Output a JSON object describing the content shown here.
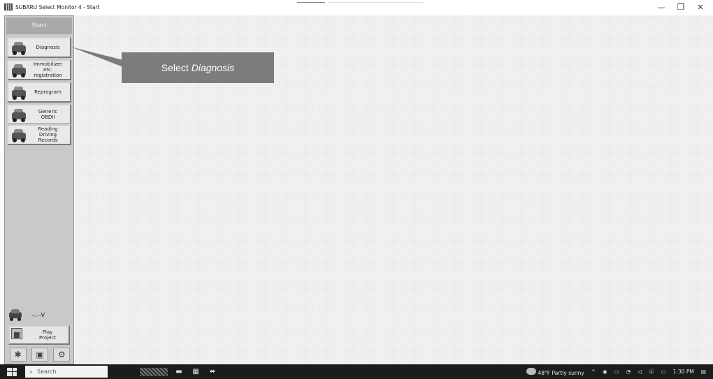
{
  "window": {
    "title": "SUBARU Select Monitor 4 - Start",
    "controls": {
      "minimize": "—",
      "maximize": "❐",
      "close": "✕"
    }
  },
  "sidebar": {
    "header": "Start",
    "buttons": [
      {
        "label": "Diagnosis",
        "icon": "car-diagnosis-icon"
      },
      {
        "label": "Immobilizer\netc.\nregistration",
        "icon": "car-key-icon"
      },
      {
        "label": "Reprogram",
        "icon": "car-reprogram-icon"
      },
      {
        "label": "Generic\nOBDII",
        "icon": "car-obd-icon"
      },
      {
        "label": "Reading\nDriving\nRecords",
        "icon": "car-records-icon"
      }
    ],
    "voltage": "--.--V",
    "play_project": "Play\nProject",
    "tools": [
      "settings-gear-icon",
      "save-icon",
      "cog-icon"
    ]
  },
  "callout": {
    "prefix": "Select",
    "emphasis": "Diagnosis"
  },
  "taskbar": {
    "search_placeholder": "Search",
    "weather": "48°F  Partly sunny",
    "time": "1:30 PM"
  }
}
